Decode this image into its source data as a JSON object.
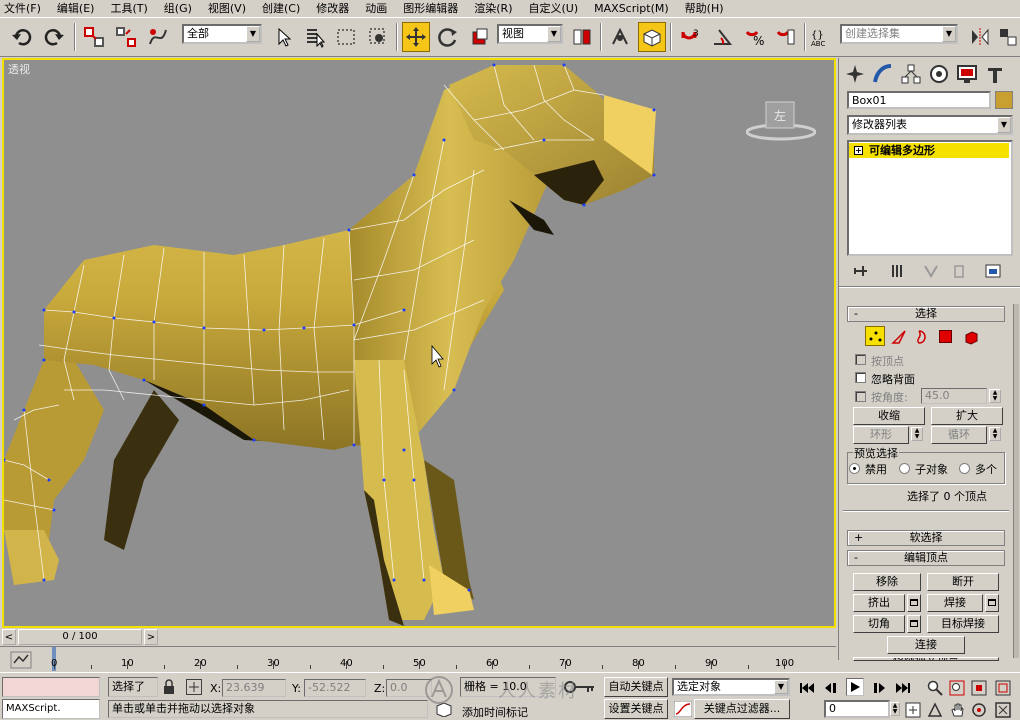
{
  "menu": [
    "文件(F)",
    "编辑(E)",
    "工具(T)",
    "组(G)",
    "视图(V)",
    "创建(C)",
    "修改器",
    "动画",
    "图形编辑器",
    "渲染(R)",
    "自定义(U)",
    "MAXScript(M)",
    "帮助(H)"
  ],
  "toolbar": {
    "selection_filter": "全部",
    "ref_coord": "视图",
    "named_selection_placeholder": "创建选择集",
    "icons": [
      "undo-icon",
      "redo-icon",
      "link-icon",
      "unlink-icon",
      "bind-spacewarp-icon",
      "select-icon",
      "select-by-name-icon",
      "rect-select-icon",
      "window-crossing-icon",
      "move-icon",
      "rotate-icon",
      "scale-icon",
      "pivot-icon",
      "manipulate-icon",
      "keyboard-shortcut-icon",
      "snap-3d-icon",
      "angle-snap-icon",
      "percent-snap-icon",
      "spinner-snap-icon",
      "edit-named-sel-icon",
      "mirror-icon",
      "align-icon"
    ]
  },
  "viewport": {
    "label": "透视",
    "viewcube_label": "左",
    "border_color": "#f2e000",
    "background": "#8f8f8f",
    "model_color": "#c8a83a"
  },
  "command_panel": {
    "object_name": "Box01",
    "object_color": "#c8a030",
    "modifier_list_label": "修改器列表",
    "stack": [
      {
        "label": "可编辑多边形",
        "selected": true
      }
    ],
    "selection": {
      "title": "选择",
      "by_vertex": "按顶点",
      "ignore_backfacing": "忽略背面",
      "by_angle": "按角度:",
      "angle_value": "45.0",
      "shrink": "收缩",
      "grow": "扩大",
      "ring": "环形",
      "loop": "循环",
      "preview_title": "预览选择",
      "preview_options": [
        "禁用",
        "子对象",
        "多个"
      ],
      "status": "选择了 0 个顶点"
    },
    "soft_selection_title": "软选择",
    "edit_vertices": {
      "title": "编辑顶点",
      "remove": "移除",
      "break": "断开",
      "extrude": "挤出",
      "weld": "焊接",
      "chamfer": "切角",
      "target_weld": "目标焊接",
      "connect": "连接",
      "remove_isolated": "移除孤立顶点"
    }
  },
  "timeline": {
    "frame_display": "0 / 100",
    "ticks": [
      "0",
      "10",
      "20",
      "30",
      "40",
      "50",
      "60",
      "70",
      "80",
      "90",
      "100"
    ]
  },
  "status": {
    "maxscript_label": "MAXScript.",
    "selected_label": "选择了",
    "x_label": "X:",
    "x_value": "23.639",
    "y_label": "Y:",
    "y_value": "-52.522",
    "z_label": "Z:",
    "z_value": "0.0",
    "grid": "栅格 = 10.0",
    "auto_key": "自动关键点",
    "set_key": "设置关键点",
    "key_mode": "选定对象",
    "key_filters": "关键点过滤器...",
    "frame_field": "0",
    "prompt": "单击或单击并拖动以选择对象",
    "add_time_tag": "添加时间标记",
    "watermark": "人人素材"
  }
}
